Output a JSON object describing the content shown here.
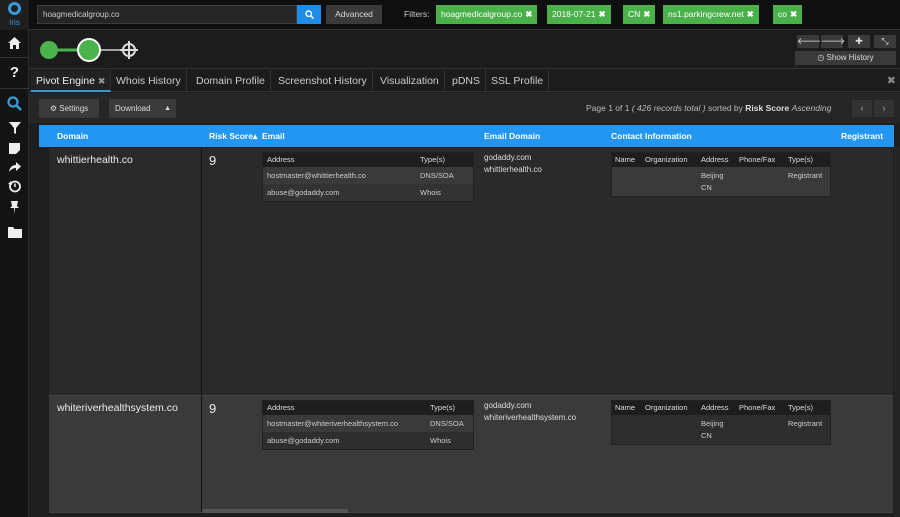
{
  "app": {
    "logo_text": "Iris"
  },
  "sidebar": {
    "icons": [
      "home-icon",
      "help-icon",
      "search-icon",
      "filter-icon",
      "note-icon",
      "share-icon",
      "history-icon",
      "pin-icon",
      "folder-icon"
    ]
  },
  "topbar": {
    "search_value": "hoagmedicalgroup.co",
    "advanced_label": "Advanced",
    "filters_label": "Filters:",
    "filters": [
      "hoagmedicalgroup.co",
      "2018-07-21",
      "CN",
      "ns1.parkingcrew.net",
      "co"
    ]
  },
  "graphbar": {
    "show_history_label": "Show History"
  },
  "tabs": [
    "Pivot Engine",
    "Whois History",
    "Domain Profile",
    "Screenshot History",
    "Visualization",
    "pDNS",
    "SSL Profile"
  ],
  "toolbar": {
    "settings_label": "Settings",
    "download_label": "Download",
    "page_prefix": "Page 1 of 1",
    "records_text": "( 426 records total )",
    "sorted_by_prefix": "sorted by",
    "sort_field": "Risk Score",
    "sort_dir": "Ascending"
  },
  "table": {
    "columns": [
      "Domain",
      "Risk Score",
      "Email",
      "Email Domain",
      "Contact Information",
      "Registrant"
    ],
    "email_sub_headers": [
      "Address",
      "Type(s)"
    ],
    "contact_sub_headers": [
      "Name",
      "Organization",
      "Address",
      "Phone/Fax",
      "Type(s)"
    ],
    "rows": [
      {
        "domain": "whittierhealth.co",
        "risk": "9",
        "emails": [
          {
            "address": "hostmaster@whittierhealth.co",
            "type": "DNS/SOA"
          },
          {
            "address": "abuse@godaddy.com",
            "type": "Whois"
          }
        ],
        "email_domains": [
          "godaddy.com",
          "whittierhealth.co"
        ],
        "contact": {
          "address1": "Beijing",
          "address2": "CN",
          "type": "Registrant"
        }
      },
      {
        "domain": "whiteriverhealthsystem.co",
        "risk": "9",
        "emails": [
          {
            "address": "hostmaster@whiteriverhealthsystem.co",
            "type": "DNS/SOA"
          },
          {
            "address": "abuse@godaddy.com",
            "type": "Whois"
          }
        ],
        "email_domains": [
          "godaddy.com",
          "whiteriverhealthsystem.co"
        ],
        "contact": {
          "address1": "Beijing",
          "address2": "CN",
          "type": "Registrant"
        }
      }
    ]
  },
  "colors": {
    "accent": "#2296f0",
    "chip": "#49b04a"
  }
}
